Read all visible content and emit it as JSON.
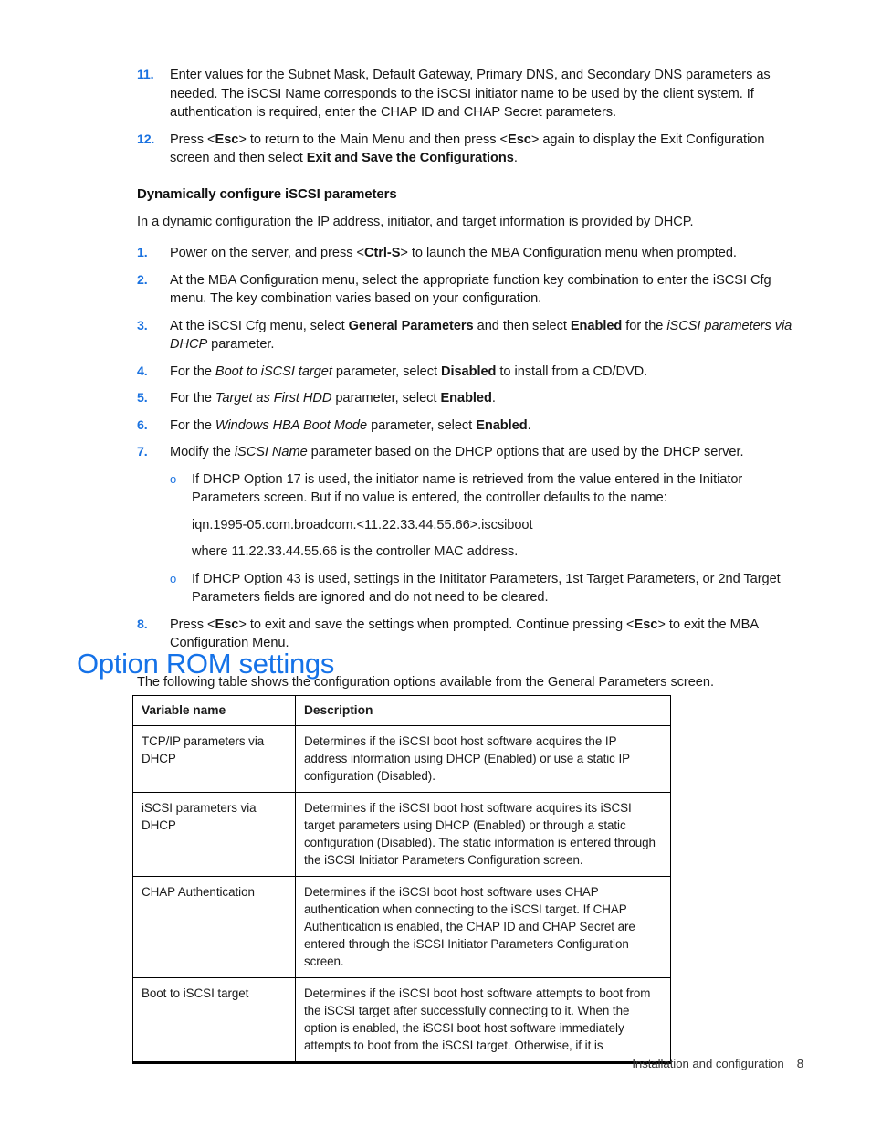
{
  "document": {
    "steps_top": [
      {
        "number": "11.",
        "text": "Enter values for the Subnet Mask, Default Gateway, Primary DNS, and Secondary DNS parameters as needed. The iSCSI Name corresponds to the iSCSI initiator name to be used by the client system. If authentication is required, enter the CHAP ID and CHAP Secret parameters."
      },
      {
        "number": "12.",
        "text_parts": {
          "a": "Press <",
          "b1": "Esc",
          "c": "> to return to the Main Menu and then press <",
          "b2": "Esc",
          "d": "> again to display the Exit Configuration screen and then select ",
          "b3": "Exit and Save the Configurations",
          "e": "."
        }
      }
    ],
    "section_heading": "Dynamically configure iSCSI parameters",
    "section_intro": "In a dynamic configuration the IP address, initiator, and target information is provided by DHCP.",
    "steps": [
      {
        "number": "1.",
        "parts": {
          "a": "Power on the server, and press <",
          "b": "Ctrl-S",
          "c": "> to launch the MBA Configuration menu when prompted."
        }
      },
      {
        "number": "2.",
        "parts": {
          "a": "At the MBA Configuration menu, select the appropriate function key combination to enter the iSCSI Cfg menu. The key combination varies based on your configuration.",
          "b": "",
          "c": ""
        }
      },
      {
        "number": "3.",
        "parts": {
          "a": "At the iSCSI Cfg menu, select ",
          "b": "General Parameters",
          "c": " and then select ",
          "d": "Enabled",
          "e": " for the ",
          "f": "iSCSI parameters via DHCP",
          "g": " parameter."
        }
      },
      {
        "number": "4.",
        "parts": {
          "a": "For the ",
          "f": "Boot to iSCSI target",
          "e": " parameter, select ",
          "d": "Disabled",
          "g": " to install from a CD/DVD."
        }
      },
      {
        "number": "5.",
        "parts": {
          "a": "For the ",
          "f": "Target as First HDD",
          "e": " parameter, select ",
          "d": "Enabled",
          "g": "."
        }
      },
      {
        "number": "6.",
        "parts": {
          "a": "For the ",
          "f": "Windows HBA Boot Mode",
          "e": " parameter, select ",
          "d": "Enabled",
          "g": "."
        }
      },
      {
        "number": "7.",
        "parts": {
          "a": "Modify the ",
          "f": "iSCSI Name",
          "e": " parameter based on the DHCP options that are used by the DHCP server.",
          "d": "",
          "g": ""
        }
      }
    ],
    "sub_bullets": [
      {
        "marker": "o",
        "text": "If DHCP Option 17 is used, the initiator name is retrieved from the value entered in the Initiator Parameters screen. But if no value is entered, the controller defaults to the name:"
      },
      {
        "marker": "o",
        "text": "If DHCP Option 43 is used, settings in the Inititator Parameters, 1st Target Parameters, or 2nd Target Parameters fields are ignored and do not need to be cleared."
      }
    ],
    "iqn_line": "iqn.1995-05.com.broadcom.<11.22.33.44.55.66>.iscsiboot",
    "mac_line": "where 11.22.33.44.55.66 is the controller MAC address.",
    "step8": {
      "number": "8.",
      "parts": {
        "a": "Press <",
        "b1": "Esc",
        "c": "> to exit and save the settings when prompted. Continue pressing <",
        "b2": "Esc",
        "d": "> to exit the MBA Configuration Menu."
      }
    },
    "main_heading": "Option ROM settings",
    "table_intro": "The following table shows the configuration options available from the General Parameters screen.",
    "table": {
      "headers": [
        "Variable name",
        "Description"
      ],
      "rows": [
        {
          "name": "TCP/IP parameters via DHCP",
          "description": "Determines if the iSCSI boot host software acquires the IP address information using DHCP (Enabled) or use a static IP configuration (Disabled)."
        },
        {
          "name": "iSCSI parameters via DHCP",
          "description": "Determines if  the iSCSI boot host software acquires its iSCSI target parameters using DHCP (Enabled) or through a static configuration (Disabled). The static information is entered through the iSCSI Initiator Parameters Configuration screen."
        },
        {
          "name": "CHAP Authentication",
          "description": "Determines if the iSCSI boot host software uses CHAP authentication when connecting to the iSCSI target. If CHAP Authentication is enabled, the CHAP ID and CHAP Secret are entered through the iSCSI Initiator Parameters Configuration screen."
        },
        {
          "name": "Boot to iSCSI target",
          "description": "Determines if the iSCSI boot host software attempts to boot from the iSCSI target after successfully connecting to it. When the option is enabled, the iSCSI boot host software immediately attempts to boot from the iSCSI target. Otherwise, if it is"
        }
      ]
    },
    "footer": {
      "text": "Installation and configuration",
      "page_number": "8"
    },
    "colors": {
      "heading_blue": "#1572E8",
      "marker_blue": "#1a72e0",
      "body_text": "#161616",
      "table_border": "#000000"
    }
  }
}
